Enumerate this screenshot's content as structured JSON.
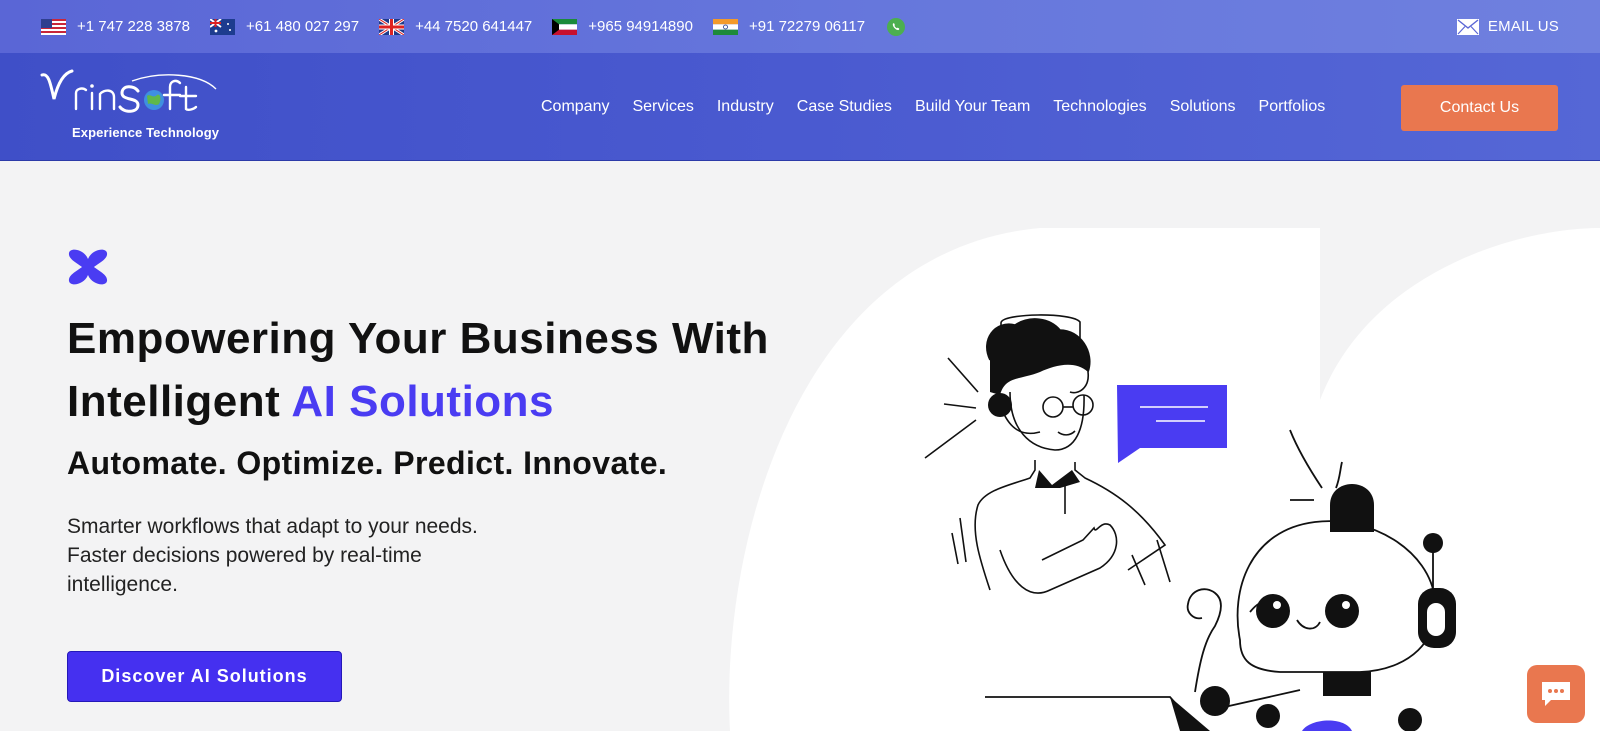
{
  "topbar": {
    "phones": [
      {
        "country": "us",
        "number": "+1 747 228 3878"
      },
      {
        "country": "au",
        "number": "+61 480 027 297"
      },
      {
        "country": "gb",
        "number": "+44 7520 641447"
      },
      {
        "country": "kw",
        "number": "+965 94914890"
      },
      {
        "country": "in",
        "number": "+91 72279 06117"
      }
    ],
    "whatsapp_icon": "whatsapp-icon",
    "email_label": "EMAIL US"
  },
  "logo": {
    "name": "VrinSoft",
    "tagline": "Experience Technology"
  },
  "nav": {
    "items": [
      "Company",
      "Services",
      "Industry",
      "Case Studies",
      "Build Your Team",
      "Technologies",
      "Solutions",
      "Portfolios"
    ],
    "contact_label": "Contact Us"
  },
  "hero": {
    "title_line1": "Empowering Your Business With",
    "title_line2_plain": "Intelligent ",
    "title_line2_accent": "AI Solutions",
    "subtitle": "Automate. Optimize. Predict. Innovate.",
    "para_line1": "Smarter workflows that adapt to your needs.",
    "para_line2": "Faster decisions powered by real-time",
    "para_line3": "intelligence.",
    "cta_label": "Discover AI Solutions"
  },
  "colors": {
    "accent": "#4a3cf2",
    "cta": "#e9774f",
    "nav": "#4a5ad0"
  }
}
